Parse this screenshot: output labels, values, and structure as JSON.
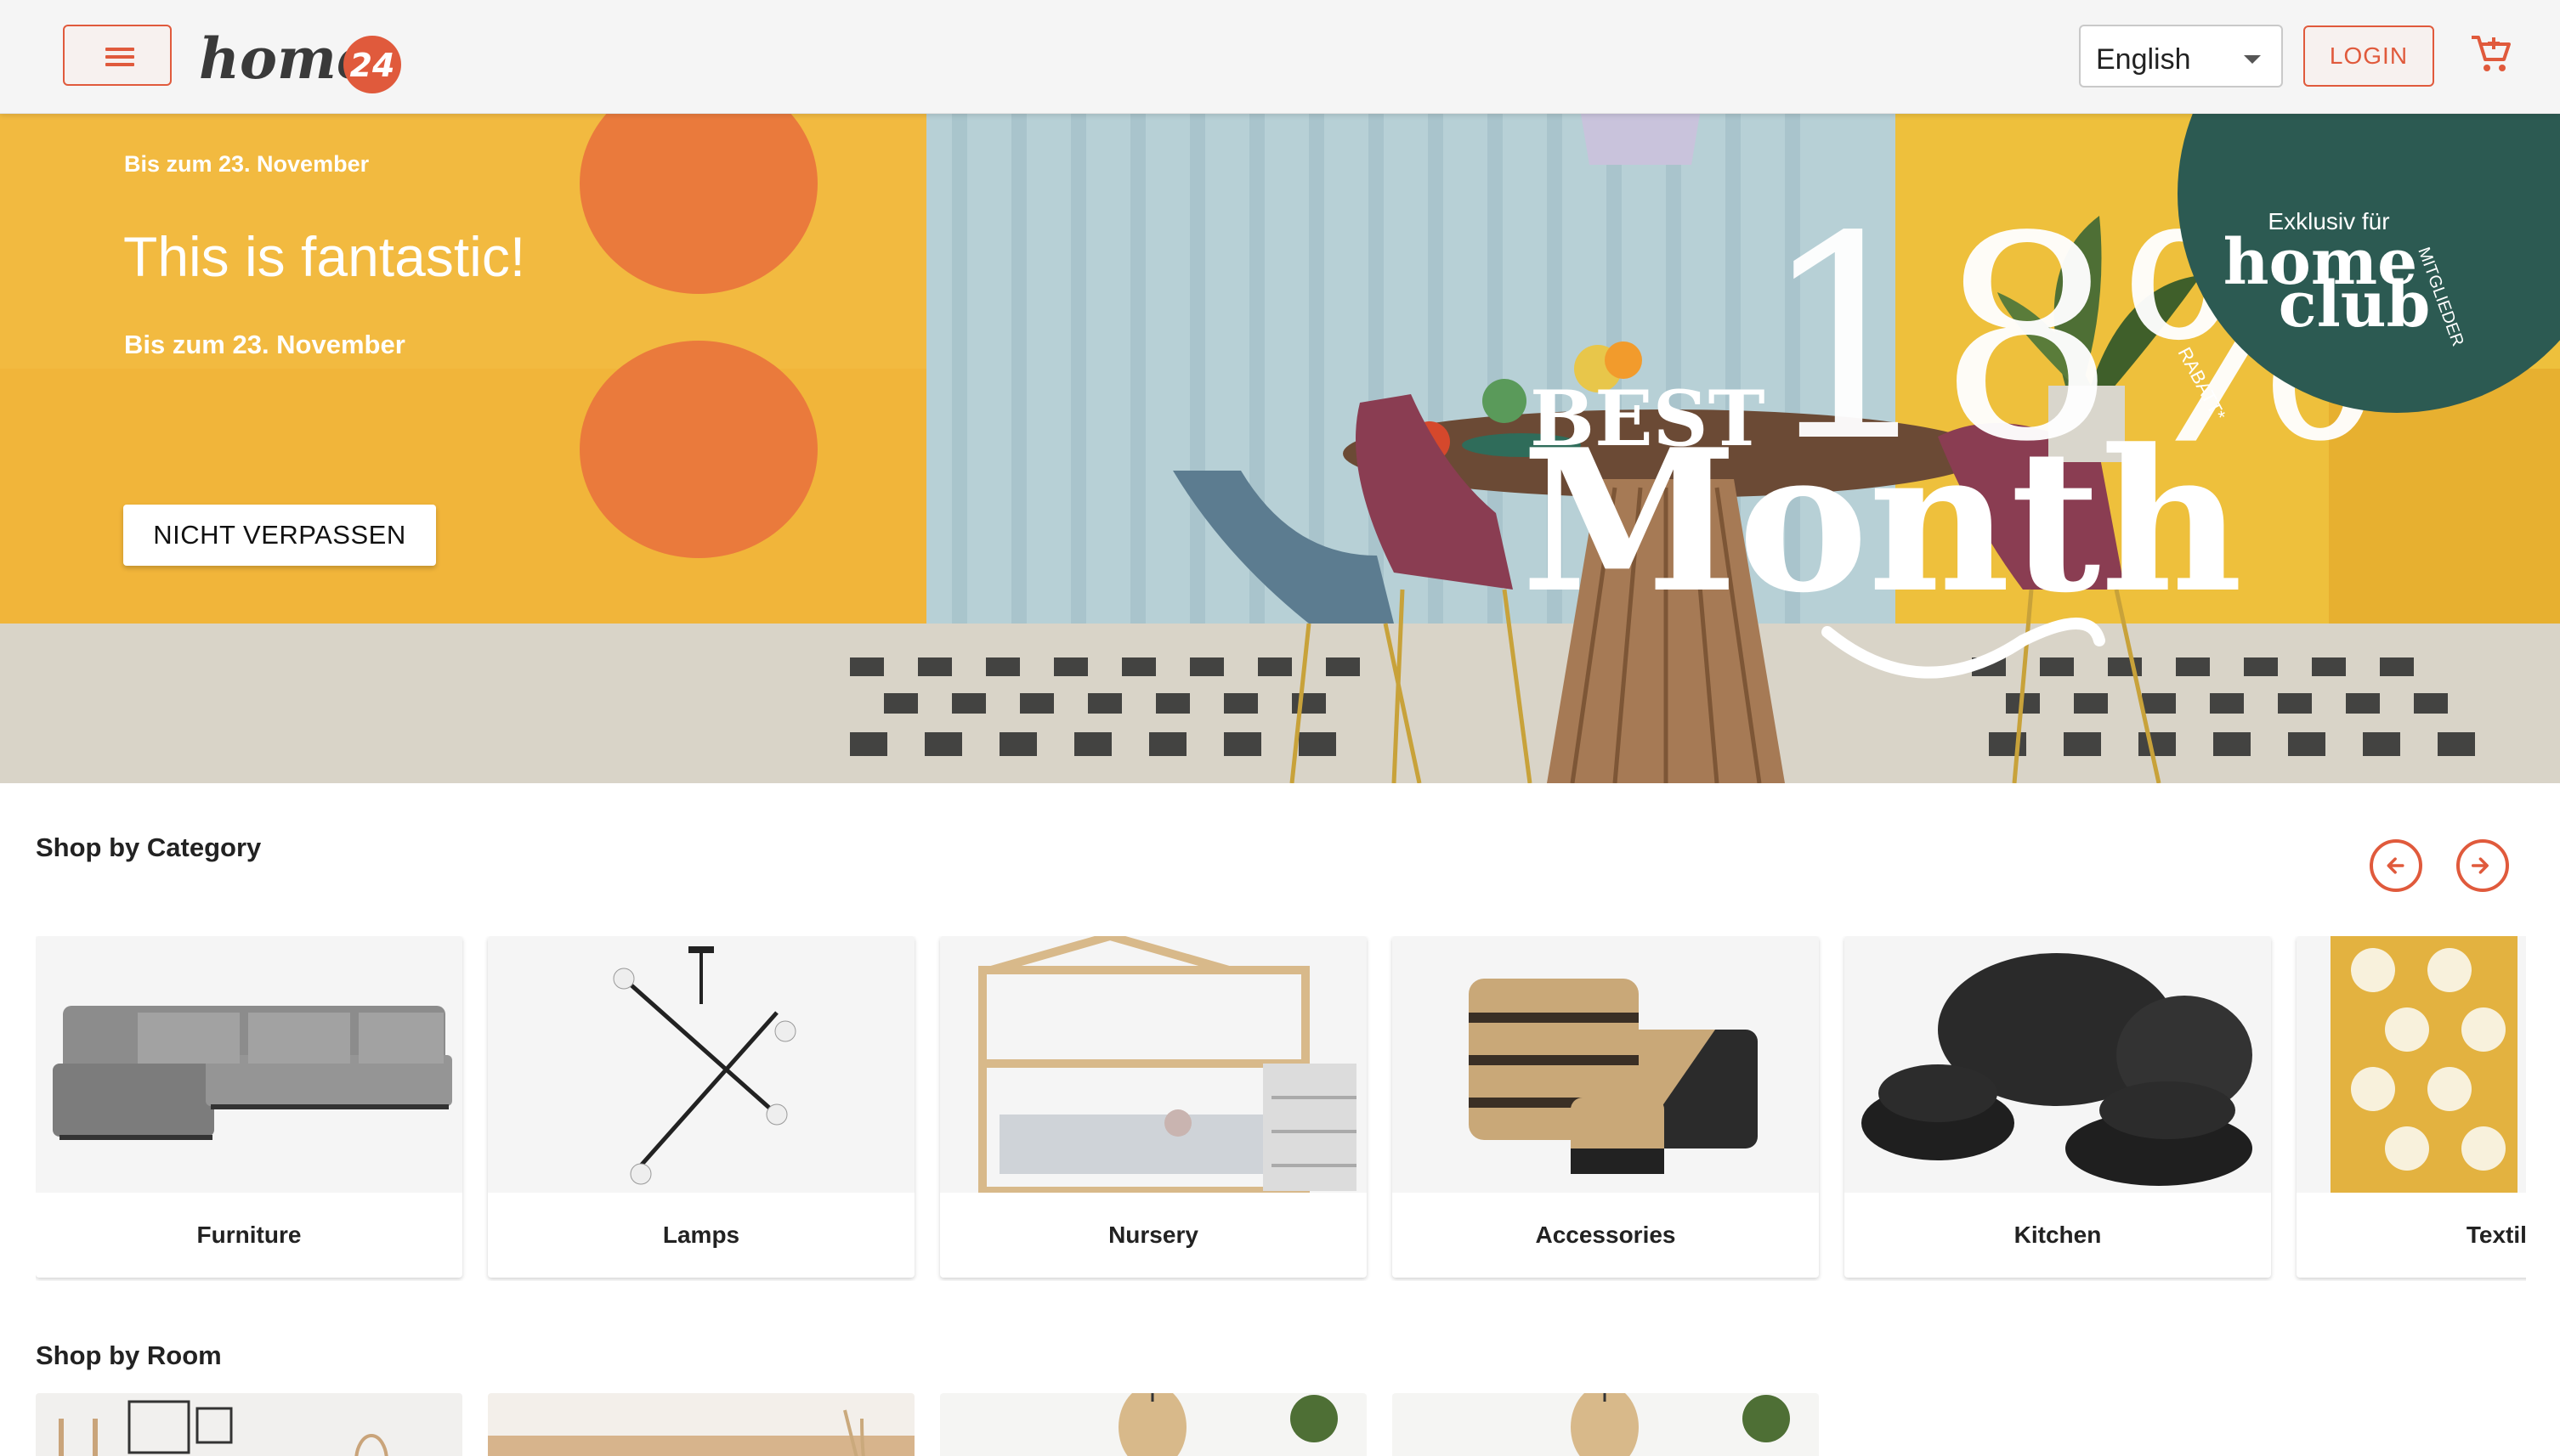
{
  "header": {
    "language": "English",
    "login_label": "LOGIN",
    "logo_text": "home",
    "logo_badge": "24"
  },
  "hero": {
    "kicker": "Bis zum 23. November",
    "title": "This is fantastic!",
    "subtitle": "Bis zum 23. November",
    "cta_label": "NICHT VERPASSEN",
    "promo_best": "BEST",
    "promo_percent": "18%",
    "promo_month": "Month",
    "club_line1": "Exklusiv für",
    "club_line2": "home",
    "club_line3": "club",
    "club_mitglieder": "MITGLIEDER",
    "club_rabatt": "RABATT*"
  },
  "categories": {
    "title": "Shop by Category",
    "items": [
      {
        "label": "Furniture"
      },
      {
        "label": "Lamps"
      },
      {
        "label": "Nursery"
      },
      {
        "label": "Accessories"
      },
      {
        "label": "Kitchen"
      },
      {
        "label": "Textiles"
      }
    ]
  },
  "rooms": {
    "title": "Shop by Room"
  },
  "colors": {
    "accent": "#e05a3c",
    "hero_yellow": "#f2b83a",
    "club_green": "#2c5a52"
  },
  "icons": {
    "menu": "hamburger-icon",
    "cart": "cart-icon",
    "prev": "arrow-left-circle-icon",
    "next": "arrow-right-circle-icon"
  }
}
